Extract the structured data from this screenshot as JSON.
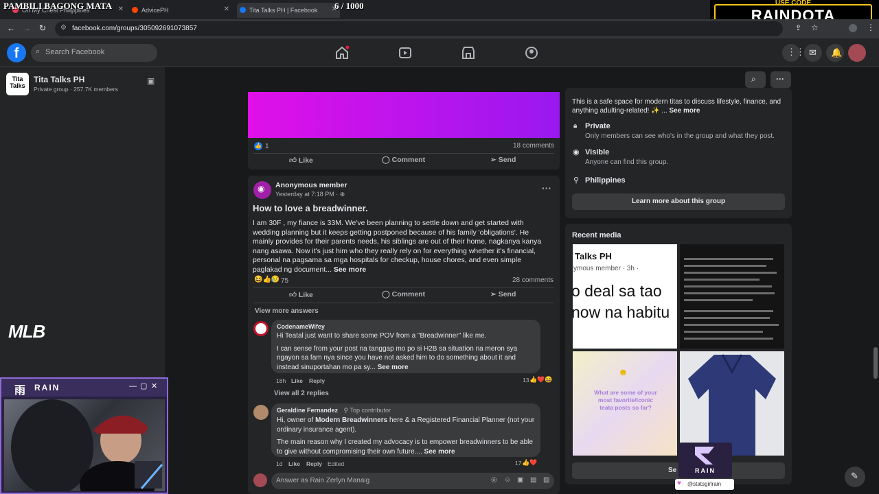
{
  "browser": {
    "tabs": [
      {
        "label": "Oh My Chest Philippines",
        "color": "#e94057"
      },
      {
        "label": "AdvicePH",
        "color": "#ff4500"
      },
      {
        "label": "Tita Talks PH | Facebook",
        "color": "#1877f2"
      }
    ],
    "url": "facebook.com/groups/305092691073857"
  },
  "overlay": {
    "title": "PAMBILI BAGONG MATA",
    "counter": "6   / 1000",
    "sponsor_code_label": "USE CODE",
    "sponsor_code": "RAINDOTA",
    "game_logo": "MLB",
    "cam_brand": "RAIN",
    "cam_glyph": "雨",
    "watermark_brand": "RAIN",
    "watermark_handle": "@statsgirlrain"
  },
  "fb": {
    "search_placeholder": "Search Facebook",
    "group": {
      "name": "Tita Talks PH",
      "meta": "Private group · 257.7K members",
      "icon_text": "Tita Talks"
    }
  },
  "post1": {
    "reactions": "1",
    "comments": "18 comments",
    "like": "Like",
    "comment": "Comment",
    "send": "Send"
  },
  "post2": {
    "author": "Anonymous member",
    "time": "Yesterday at 7:18 PM · ",
    "title": "How to love a breadwinner.",
    "body": "I am 30F , my fiance is 33M. We've been planning to settle down and get started with wedding planning but it keeps getting postponed because of his family 'obligations'. He mainly provides for their parents needs, his siblings are out of their home, nagkanya kanya nang asawa. Now it's just him who they really rely on for everything whether it's financial, personal na pagsama sa mga hospitals for checkup, house chores, and even simple paglakad ng document...",
    "see_more": "See more",
    "reactions": "75",
    "comments": "28 comments",
    "like": "Like",
    "comment": "Comment",
    "send": "Send",
    "view_more": "View more answers"
  },
  "comment1": {
    "author": "CodenameWifey",
    "line1": "Hi Teatal just want to share some POV from a \"Breadwinner\" like me.",
    "line2": "I can sense from your post na tanggap mo po si H2B sa situation na meron sya ngayon sa fam nya since you have not asked him to do something about it and instead sinuportahan mo pa sy...",
    "see_more": "See more",
    "time": "18h",
    "like": "Like",
    "reply": "Reply",
    "react_count": "13",
    "view_replies": "View all 2 replies"
  },
  "comment2": {
    "author": "Geraldine Fernandez",
    "badge": "Top contributor",
    "line1_a": "Hi, owner of ",
    "line1_b": "Modern Breadwinners",
    "line1_c": " here & a Registered Financial Planner (not your ordinary insurance agent).",
    "line2": "The main reason why I created my advocacy is to empower breadwinners to be able to give without compromising their own future....",
    "see_more": "See more",
    "time": "1d",
    "like": "Like",
    "reply": "Reply",
    "edited": "Edited",
    "react_count": "17"
  },
  "answer_placeholder": "Answer as Rain Zerlyn Manaig",
  "about": {
    "desc": "This is a safe space for modern titas to discuss lifestyle, finance, and anything adulting-related! ✨ ...",
    "see_more": "See more",
    "private_title": "Private",
    "private_sub": "Only members can see who's in the group and what they post.",
    "visible_title": "Visible",
    "visible_sub": "Anyone can find this group.",
    "location": "Philippines",
    "learn_more": "Learn more about this group"
  },
  "media": {
    "title": "Recent media",
    "tile1_line1": "Talks PH",
    "tile1_line2": "ymous member · 3h ·",
    "tile1_big1": "o deal sa tao",
    "tile1_big2": "now na habitu",
    "tile3_text": "What are some of your most favorite/iconic teata posts so far?",
    "see_all": "Se"
  }
}
